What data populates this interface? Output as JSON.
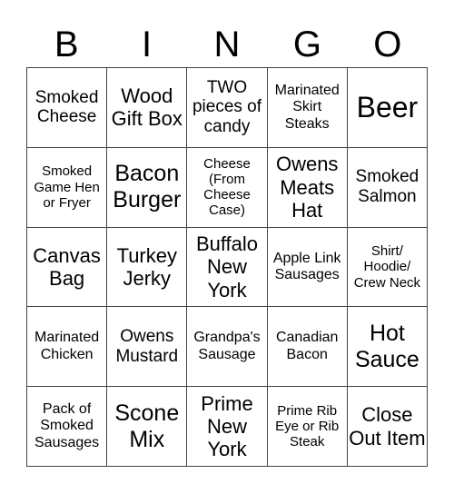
{
  "header": [
    "B",
    "I",
    "N",
    "G",
    "O"
  ],
  "cells": [
    [
      "Smoked Cheese",
      "Wood Gift Box",
      "TWO pieces of candy",
      "Marinated Skirt Steaks",
      "Beer"
    ],
    [
      "Smoked Game Hen or Fryer",
      "Bacon Burger",
      "Cheese (From Cheese Case)",
      "Owens Meats Hat",
      "Smoked Salmon"
    ],
    [
      "Canvas Bag",
      "Turkey Jerky",
      "Buffalo New York",
      "Apple Link Sausages",
      "Shirt/ Hoodie/ Crew Neck"
    ],
    [
      "Marinated Chicken",
      "Owens Mustard",
      "Grandpa's Sausage",
      "Canadian Bacon",
      "Hot Sauce"
    ],
    [
      "Pack of Smoked Sausages",
      "Scone Mix",
      "Prime New York",
      "Prime Rib Eye or Rib Steak",
      "Close Out Item"
    ]
  ]
}
